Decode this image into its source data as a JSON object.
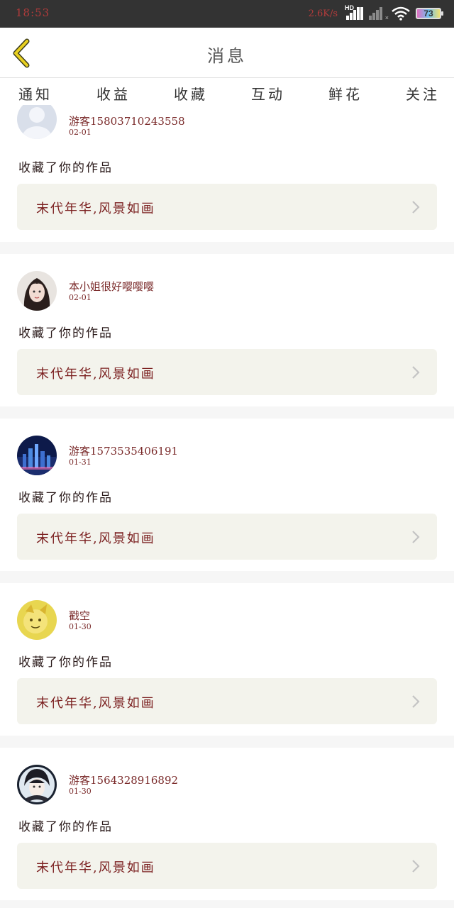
{
  "status_bar": {
    "time": "18:53",
    "speed": "2.6K/s",
    "hd": "HD",
    "battery": "73"
  },
  "header": {
    "title": "消息"
  },
  "tabs": [
    {
      "label": "通知"
    },
    {
      "label": "收益"
    },
    {
      "label": "收藏",
      "active": true
    },
    {
      "label": "互动"
    },
    {
      "label": "鲜花"
    },
    {
      "label": "关注"
    }
  ],
  "feed": [
    {
      "username": "游客15803710243558",
      "date": "02-01",
      "action": "收藏了你的作品",
      "work_title": "末代年华,风景如画",
      "avatar": "default-avatar"
    },
    {
      "username": "本小姐很好嘤嘤嘤",
      "date": "02-01",
      "action": "收藏了你的作品",
      "work_title": "末代年华,风景如画",
      "avatar": "girl-portrait-avatar"
    },
    {
      "username": "游客1573535406191",
      "date": "01-31",
      "action": "收藏了你的作品",
      "work_title": "末代年华,风景如画",
      "avatar": "night-city-avatar"
    },
    {
      "username": "戳空",
      "date": "01-30",
      "action": "收藏了你的作品",
      "work_title": "末代年华,风景如画",
      "avatar": "yellow-cartoon-avatar"
    },
    {
      "username": "游客1564328916892",
      "date": "01-30",
      "action": "收藏了你的作品",
      "work_title": "末代年华,风景如画",
      "avatar": "anime-boy-avatar"
    }
  ],
  "colors": {
    "tab_indicator": "#e0609a",
    "back_arrow": "#e8d020",
    "text_red": "#7a1e1e",
    "card_bg": "#f3f3ec"
  }
}
